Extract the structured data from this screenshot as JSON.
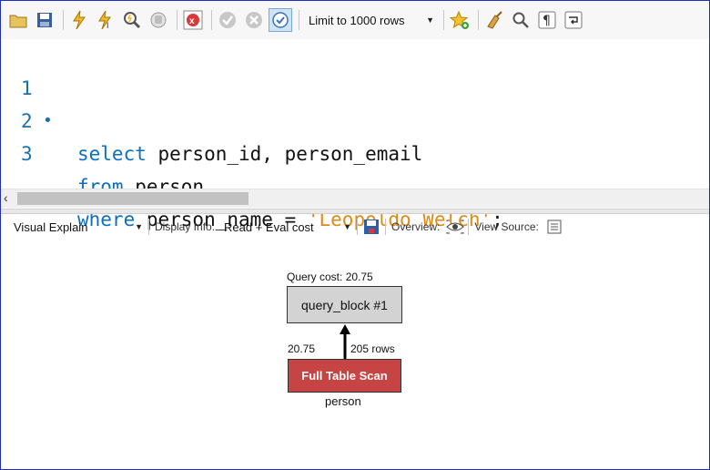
{
  "toolbar": {
    "limit_select_value": "Limit to 1000 rows"
  },
  "editor": {
    "lines": [
      {
        "number": "1",
        "marker": "•",
        "keyword": "select",
        "rest": " person_id, person_email",
        "string": "",
        "end": ""
      },
      {
        "number": "2",
        "marker": "",
        "keyword": "from",
        "rest": " person",
        "string": "",
        "end": ""
      },
      {
        "number": "3",
        "marker": "",
        "keyword": "where",
        "rest": " person_name = ",
        "string": "'Leopoldo Welch'",
        "end": ";"
      }
    ]
  },
  "explain": {
    "mode_value": "Visual Explain",
    "display_info_label": "Display Info:",
    "display_info_value": "Read + Eval cost",
    "overview_label": "Overview:",
    "view_source_label": "View Source:"
  },
  "diagram": {
    "query_cost": "Query cost: 20.75",
    "query_block": "query_block #1",
    "row_cost": "20.75",
    "rows": "205 rows",
    "scan_label": "Full Table Scan",
    "table_name": "person"
  },
  "colors": {
    "keyword": "#0b6fc2",
    "string": "#e08a14",
    "scan_fill": "#c74444",
    "block_fill": "#d3d3d3",
    "frame_border": "#1f2fb8"
  }
}
